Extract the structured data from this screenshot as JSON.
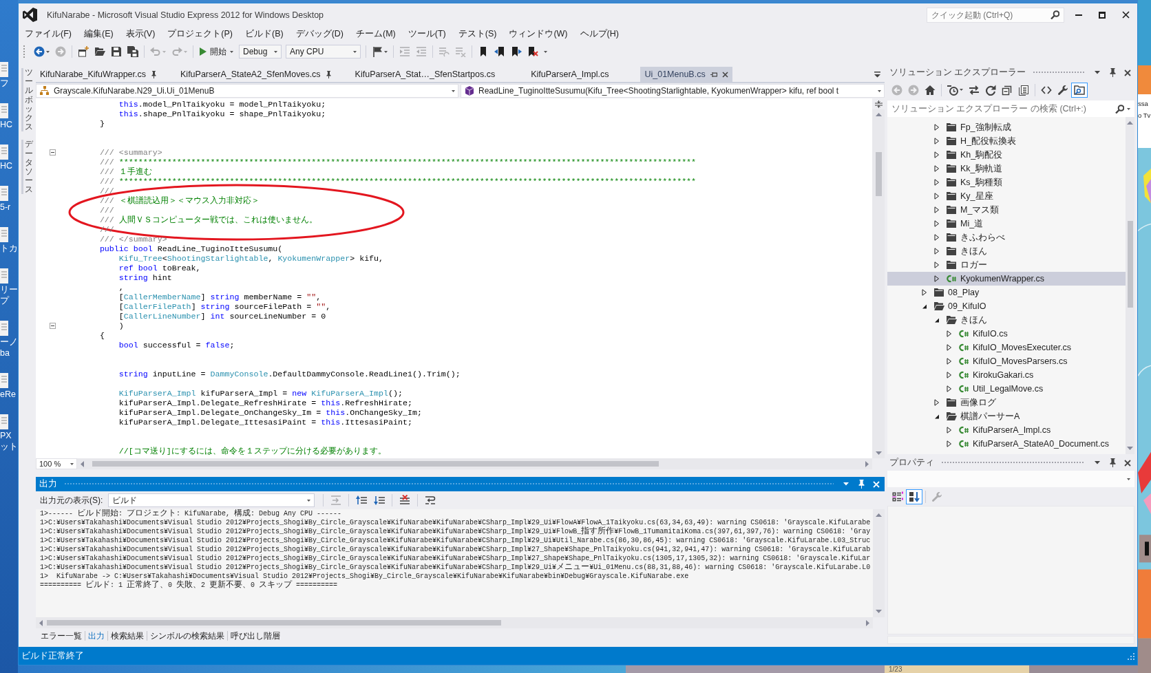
{
  "desktop": {
    "left_icons": [
      {
        "lines": [
          "フ"
        ]
      },
      {
        "lines": [
          "HC"
        ]
      },
      {
        "lines": [
          "HC"
        ]
      },
      {
        "lines": [
          "5-r"
        ]
      },
      {
        "lines": [
          "トカ"
        ]
      },
      {
        "lines": [
          "リー",
          "プ"
        ]
      },
      {
        "lines": [
          "ーノ",
          "ba"
        ]
      },
      {
        "lines": [
          "eRe"
        ]
      },
      {
        "lines": [
          "PX",
          "ット"
        ]
      }
    ],
    "right_texts": [
      "ssa",
      "o Tv"
    ],
    "taskbar_texts": [
      "1/23"
    ]
  },
  "title_bar": {
    "title": "KifuNarabe - Microsoft Visual Studio Express 2012 for Windows Desktop",
    "quick_launch": {
      "placeholder": "クイック起動 (Ctrl+Q)"
    }
  },
  "menu": [
    "ファイル(F)",
    "編集(E)",
    "表示(V)",
    "プロジェクト(P)",
    "ビルド(B)",
    "デバッグ(D)",
    "チーム(M)",
    "ツール(T)",
    "テスト(S)",
    "ウィンドウ(W)",
    "ヘルプ(H)"
  ],
  "toolbar": {
    "groups": [
      [
        {
          "kind": "nav_back",
          "disabled": false
        },
        {
          "kind": "nav_forward",
          "disabled": true
        }
      ],
      [
        {
          "kind": "new_project",
          "disabled": false
        },
        {
          "kind": "open_file",
          "disabled": false
        },
        {
          "kind": "save",
          "disabled": false
        },
        {
          "kind": "save_all",
          "disabled": false
        }
      ],
      [
        {
          "kind": "undo",
          "disabled": true
        },
        {
          "kind": "redo",
          "disabled": true
        }
      ],
      [
        {
          "kind": "start",
          "label": "開始",
          "disabled": false
        },
        {
          "kind": "combo",
          "value": "Debug",
          "disabled": false
        },
        {
          "kind": "combo",
          "value": "Any CPU",
          "disabled": false
        }
      ],
      [
        {
          "kind": "find",
          "disabled": false
        }
      ],
      [
        {
          "kind": "indent",
          "disabled": true
        },
        {
          "kind": "outdent",
          "disabled": true
        }
      ],
      [
        {
          "kind": "comment",
          "disabled": true
        },
        {
          "kind": "uncomment",
          "disabled": true
        }
      ],
      [
        {
          "kind": "bookmark",
          "disabled": false
        },
        {
          "kind": "bookmark_prev",
          "disabled": false
        },
        {
          "kind": "bookmark_next",
          "disabled": false
        },
        {
          "kind": "bookmark_clear",
          "disabled": false
        }
      ]
    ]
  },
  "tool_window_tabs": [
    "ツールボックス",
    "データソース"
  ],
  "editor": {
    "tabs": [
      {
        "label": "KifuNarabe_KifuWrapper.cs",
        "pinned": true,
        "selected": false
      },
      {
        "label": "KifuParserA_StateA2_SfenMoves.cs",
        "pinned": true,
        "selected": false
      },
      {
        "label": "KifuParserA_Stat…_SfenStartpos.cs",
        "pinned": false,
        "selected": false
      },
      {
        "label": "KifuParserA_Impl.cs",
        "pinned": false,
        "selected": false
      },
      {
        "label": "Ui_01MenuB.cs",
        "pinned": false,
        "selected": true
      }
    ],
    "type_dropdown": "Grayscale.KifuNarabe.N29_Ui.Ui_01MenuB",
    "member_dropdown": "ReadLine_TuginoItteSusumu(Kifu_Tree<ShootingStarlightable, KyokumenWrapper> kifu, ref bool t",
    "lines": [
      {
        "kind": "code",
        "fold": false,
        "circled": false,
        "segments": [
          {
            "kind": "keyword",
            "text": "            this"
          },
          {
            "kind": "plain",
            "text": ".model_PnlTaikyoku = model_PnlTaikyoku;"
          }
        ]
      },
      {
        "kind": "code",
        "fold": false,
        "circled": false,
        "segments": [
          {
            "kind": "keyword",
            "text": "            this"
          },
          {
            "kind": "plain",
            "text": ".shape_PnlTaikyoku = shape_PnlTaikyoku;"
          }
        ]
      },
      {
        "kind": "code",
        "fold": false,
        "circled": false,
        "segments": [
          {
            "kind": "plain",
            "text": "        }"
          }
        ]
      },
      {
        "kind": "blank",
        "fold": false,
        "circled": false
      },
      {
        "kind": "blank",
        "fold": false,
        "circled": false
      },
      {
        "kind": "code",
        "fold": true,
        "circled": false,
        "segments": [
          {
            "kind": "doc_marker",
            "text": "        /// <summary>"
          }
        ]
      },
      {
        "kind": "code",
        "fold": false,
        "circled": false,
        "segments": [
          {
            "kind": "doc_marker",
            "text": "        ///"
          },
          {
            "kind": "comment",
            "text": " ************************************************************************************************************************"
          }
        ]
      },
      {
        "kind": "code",
        "fold": false,
        "circled": false,
        "segments": [
          {
            "kind": "doc_marker",
            "text": "        ///"
          },
          {
            "kind": "comment",
            "text": " １手進む"
          }
        ]
      },
      {
        "kind": "code",
        "fold": false,
        "circled": false,
        "segments": [
          {
            "kind": "doc_marker",
            "text": "        ///"
          },
          {
            "kind": "comment",
            "text": " ************************************************************************************************************************"
          }
        ]
      },
      {
        "kind": "code",
        "fold": false,
        "circled": true,
        "segments": [
          {
            "kind": "doc_marker",
            "text": "        ///"
          }
        ]
      },
      {
        "kind": "code",
        "fold": false,
        "circled": true,
        "segments": [
          {
            "kind": "doc_marker",
            "text": "        ///"
          },
          {
            "kind": "comment",
            "text": " ＜棋譜読込用＞＜マウス入力非対応＞"
          }
        ]
      },
      {
        "kind": "code",
        "fold": false,
        "circled": true,
        "segments": [
          {
            "kind": "doc_marker",
            "text": "        ///"
          }
        ]
      },
      {
        "kind": "code",
        "fold": false,
        "circled": true,
        "segments": [
          {
            "kind": "doc_marker",
            "text": "        ///"
          },
          {
            "kind": "comment",
            "text": " 人間ＶＳコンピューター戦では、これは使いません。"
          }
        ]
      },
      {
        "kind": "code",
        "fold": false,
        "circled": true,
        "segments": [
          {
            "kind": "doc_marker",
            "text": "        ///"
          }
        ]
      },
      {
        "kind": "code",
        "fold": false,
        "circled": false,
        "segments": [
          {
            "kind": "doc_marker",
            "text": "        /// </summary>"
          }
        ]
      },
      {
        "kind": "code",
        "fold": false,
        "circled": false,
        "segments": [
          {
            "kind": "keyword",
            "text": "        public bool"
          },
          {
            "kind": "plain",
            "text": " ReadLine_TuginoItteSusumu("
          }
        ]
      },
      {
        "kind": "code",
        "fold": false,
        "circled": false,
        "segments": [
          {
            "kind": "type",
            "text": "            Kifu_Tree"
          },
          {
            "kind": "plain",
            "text": "<"
          },
          {
            "kind": "type",
            "text": "ShootingStarlightable"
          },
          {
            "kind": "plain",
            "text": ", "
          },
          {
            "kind": "type",
            "text": "KyokumenWrapper"
          },
          {
            "kind": "plain",
            "text": "> kifu,"
          }
        ]
      },
      {
        "kind": "code",
        "fold": false,
        "circled": false,
        "segments": [
          {
            "kind": "keyword",
            "text": "            ref bool"
          },
          {
            "kind": "plain",
            "text": " toBreak,"
          }
        ]
      },
      {
        "kind": "code",
        "fold": false,
        "circled": false,
        "segments": [
          {
            "kind": "keyword",
            "text": "            string"
          },
          {
            "kind": "plain",
            "text": " hint"
          }
        ]
      },
      {
        "kind": "code",
        "fold": false,
        "circled": false,
        "segments": [
          {
            "kind": "plain",
            "text": "            ,"
          }
        ]
      },
      {
        "kind": "code",
        "fold": false,
        "circled": false,
        "segments": [
          {
            "kind": "plain",
            "text": "            ["
          },
          {
            "kind": "type",
            "text": "CallerMemberName"
          },
          {
            "kind": "plain",
            "text": "] "
          },
          {
            "kind": "keyword",
            "text": "string"
          },
          {
            "kind": "plain",
            "text": " memberName = "
          },
          {
            "kind": "string",
            "text": "\"\""
          },
          {
            "kind": "plain",
            "text": ","
          }
        ]
      },
      {
        "kind": "code",
        "fold": false,
        "circled": false,
        "segments": [
          {
            "kind": "plain",
            "text": "            ["
          },
          {
            "kind": "type",
            "text": "CallerFilePath"
          },
          {
            "kind": "plain",
            "text": "] "
          },
          {
            "kind": "keyword",
            "text": "string"
          },
          {
            "kind": "plain",
            "text": " sourceFilePath = "
          },
          {
            "kind": "string",
            "text": "\"\""
          },
          {
            "kind": "plain",
            "text": ","
          }
        ]
      },
      {
        "kind": "code",
        "fold": false,
        "circled": false,
        "segments": [
          {
            "kind": "plain",
            "text": "            ["
          },
          {
            "kind": "type",
            "text": "CallerLineNumber"
          },
          {
            "kind": "plain",
            "text": "] "
          },
          {
            "kind": "keyword",
            "text": "int"
          },
          {
            "kind": "plain",
            "text": " sourceLineNumber = 0"
          }
        ]
      },
      {
        "kind": "code",
        "fold": true,
        "circled": false,
        "segments": [
          {
            "kind": "plain",
            "text": "            )"
          }
        ]
      },
      {
        "kind": "code",
        "fold": false,
        "circled": false,
        "segments": [
          {
            "kind": "plain",
            "text": "        {"
          }
        ]
      },
      {
        "kind": "code",
        "fold": false,
        "circled": false,
        "segments": [
          {
            "kind": "keyword",
            "text": "            bool"
          },
          {
            "kind": "plain",
            "text": " successful = "
          },
          {
            "kind": "keyword",
            "text": "false"
          },
          {
            "kind": "plain",
            "text": ";"
          }
        ]
      },
      {
        "kind": "blank",
        "fold": false,
        "circled": false
      },
      {
        "kind": "blank",
        "fold": false,
        "circled": false
      },
      {
        "kind": "code",
        "fold": false,
        "circled": false,
        "segments": [
          {
            "kind": "keyword",
            "text": "            string"
          },
          {
            "kind": "plain",
            "text": " inputLine = "
          },
          {
            "kind": "type",
            "text": "DammyConsole"
          },
          {
            "kind": "plain",
            "text": ".DefaultDammyConsole.ReadLine1().Trim();"
          }
        ]
      },
      {
        "kind": "blank",
        "fold": false,
        "circled": false
      },
      {
        "kind": "code",
        "fold": false,
        "circled": false,
        "segments": [
          {
            "kind": "type",
            "text": "            KifuParserA_Impl"
          },
          {
            "kind": "plain",
            "text": " kifuParserA_Impl = "
          },
          {
            "kind": "keyword",
            "text": "new"
          },
          {
            "kind": "type",
            "text": " KifuParserA_Impl"
          },
          {
            "kind": "plain",
            "text": "();"
          }
        ]
      },
      {
        "kind": "code",
        "fold": false,
        "circled": false,
        "segments": [
          {
            "kind": "plain",
            "text": "            kifuParserA_Impl.Delegate_RefreshHirate = "
          },
          {
            "kind": "keyword",
            "text": "this"
          },
          {
            "kind": "plain",
            "text": ".RefreshHirate;"
          }
        ]
      },
      {
        "kind": "code",
        "fold": false,
        "circled": false,
        "segments": [
          {
            "kind": "plain",
            "text": "            kifuParserA_Impl.Delegate_OnChangeSky_Im = "
          },
          {
            "kind": "keyword",
            "text": "this"
          },
          {
            "kind": "plain",
            "text": ".OnChangeSky_Im;"
          }
        ]
      },
      {
        "kind": "code",
        "fold": false,
        "circled": false,
        "segments": [
          {
            "kind": "plain",
            "text": "            kifuParserA_Impl.Delegate_IttesasiPaint = "
          },
          {
            "kind": "keyword",
            "text": "this"
          },
          {
            "kind": "plain",
            "text": ".IttesasiPaint;"
          }
        ]
      },
      {
        "kind": "blank",
        "fold": false,
        "circled": false
      },
      {
        "kind": "blank",
        "fold": false,
        "circled": false
      },
      {
        "kind": "code",
        "fold": false,
        "circled": false,
        "segments": [
          {
            "kind": "comment",
            "text": "            //[コマ送り]にするには、命令を１ステップに分ける必要があります。"
          }
        ]
      }
    ],
    "zoom": "100 %"
  },
  "solution_explorer": {
    "title": "ソリューション エクスプローラー",
    "active": false,
    "toolbar": [
      [
        {
          "kind": "se_back",
          "disabled": true,
          "on": false
        },
        {
          "kind": "se_forward",
          "disabled": true,
          "on": false
        },
        {
          "kind": "home",
          "disabled": false,
          "on": false
        }
      ],
      [
        {
          "kind": "history",
          "disabled": false,
          "on": false
        },
        {
          "kind": "sync",
          "disabled": false,
          "on": false
        },
        {
          "kind": "refresh",
          "disabled": false,
          "on": false
        },
        {
          "kind": "collapse_all",
          "disabled": false,
          "on": false
        },
        {
          "kind": "properties",
          "disabled": false,
          "on": false
        }
      ],
      [
        {
          "kind": "view_code",
          "disabled": false,
          "on": false
        },
        {
          "kind": "wrench",
          "disabled": false,
          "on": false
        },
        {
          "kind": "preview",
          "disabled": false,
          "on": true
        }
      ]
    ],
    "search": {
      "placeholder": "ソリューション エクスプローラー の検索 (Ctrl+:)"
    },
    "tree": {
      "continued_items": [
        {
          "label": "Fp_強制転成",
          "kind": "folder",
          "expanded": false,
          "selected": false
        },
        {
          "label": "H_配役転換表",
          "kind": "folder",
          "expanded": false,
          "selected": false
        },
        {
          "label": "Kh_駒配役",
          "kind": "folder",
          "expanded": false,
          "selected": false
        },
        {
          "label": "Kk_駒軌道",
          "kind": "folder",
          "expanded": false,
          "selected": false
        },
        {
          "label": "Ks_駒種類",
          "kind": "folder",
          "expanded": false,
          "selected": false
        },
        {
          "label": "Ky_星座",
          "kind": "folder",
          "expanded": false,
          "selected": false
        },
        {
          "label": "M_マス類",
          "kind": "folder",
          "expanded": false,
          "selected": false
        },
        {
          "label": "Mi_道",
          "kind": "folder",
          "expanded": false,
          "selected": false
        },
        {
          "label": "きふわらべ",
          "kind": "folder",
          "expanded": false,
          "selected": false
        },
        {
          "label": "きほん",
          "kind": "folder",
          "expanded": false,
          "selected": false
        },
        {
          "label": "ロガー",
          "kind": "folder",
          "expanded": false,
          "selected": false
        },
        {
          "label": "KyokumenWrapper.cs",
          "kind": "csharp_file",
          "expanded": false,
          "selected": true
        }
      ],
      "items": [
        {
          "label": "08_Play",
          "kind": "folder",
          "expanded": false,
          "selected": false
        },
        {
          "label": "09_KifuIO",
          "kind": "folder",
          "expanded": true,
          "selected": false,
          "children": [
            {
              "label": "きほん",
              "kind": "folder",
              "expanded": true,
              "selected": false,
              "children": [
                {
                  "label": "KifuIO.cs",
                  "kind": "csharp_file",
                  "expanded": false,
                  "selected": false
                },
                {
                  "label": "KifuIO_MovesExecuter.cs",
                  "kind": "csharp_file",
                  "expanded": false,
                  "selected": false
                },
                {
                  "label": "KifuIO_MovesParsers.cs",
                  "kind": "csharp_file",
                  "expanded": false,
                  "selected": false
                },
                {
                  "label": "KirokuGakari.cs",
                  "kind": "csharp_file",
                  "expanded": false,
                  "selected": false
                },
                {
                  "label": "Util_LegalMove.cs",
                  "kind": "csharp_file",
                  "expanded": false,
                  "selected": false
                }
              ]
            },
            {
              "label": "画像ログ",
              "kind": "folder",
              "expanded": false,
              "selected": false
            },
            {
              "label": "棋譜パーサーA",
              "kind": "folder",
              "expanded": true,
              "selected": false,
              "children": [
                {
                  "label": "KifuParserA_Impl.cs",
                  "kind": "csharp_file",
                  "expanded": false,
                  "selected": false
                },
                {
                  "label": "KifuParserA_StateA0_Document.cs",
                  "kind": "csharp_file",
                  "expanded": false,
                  "selected": false
                }
              ]
            }
          ]
        }
      ]
    }
  },
  "properties": {
    "title": "プロパティ",
    "active": false,
    "toolbar": [
      [
        {
          "kind": "categorized",
          "disabled": false,
          "on": false
        },
        {
          "kind": "alphabetical",
          "disabled": false,
          "on": true
        }
      ],
      [
        {
          "kind": "prop_pages",
          "disabled": true,
          "on": false
        }
      ]
    ]
  },
  "output": {
    "title": "出力",
    "active": true,
    "source_label": "出力元の表示(S):",
    "source": "ビルド",
    "toolbar": [
      [
        {
          "kind": "goto_line",
          "disabled": true,
          "on": false
        }
      ],
      [
        {
          "kind": "prev_message",
          "disabled": false,
          "on": false
        },
        {
          "kind": "next_message",
          "disabled": false,
          "on": false
        }
      ],
      [
        {
          "kind": "clear_all",
          "disabled": false,
          "on": false
        }
      ],
      [
        {
          "kind": "word_wrap",
          "disabled": false,
          "on": false
        }
      ]
    ],
    "lines": [
      "1>------ ビルド開始: プロジェクト: KifuNarabe, 構成: Debug Any CPU ------",
      "1>C:¥Users¥Takahashi¥Documents¥Visual Studio 2012¥Projects_Shogi¥By_Circle_Grayscale¥KifuNarabe¥KifuNarabe¥CSharp_Impl¥29_Ui¥FlowA¥FlowA_1Taikyoku.cs(63,34,63,49): warning CS0618: 'Grayscale.KifuLarabe",
      "1>C:¥Users¥Takahashi¥Documents¥Visual Studio 2012¥Projects_Shogi¥By_Circle_Grayscale¥KifuNarabe¥KifuNarabe¥CSharp_Impl¥29_Ui¥FlowB_指す所作¥FlowB_1TumamitaiKoma.cs(397,61,397,76): warning CS0618: 'Gray",
      "1>C:¥Users¥Takahashi¥Documents¥Visual Studio 2012¥Projects_Shogi¥By_Circle_Grayscale¥KifuNarabe¥KifuNarabe¥CSharp_Impl¥29_Ui¥Util_Narabe.cs(86,30,86,45): warning CS0618: 'Grayscale.KifuLarabe.L03_Struc",
      "1>C:¥Users¥Takahashi¥Documents¥Visual Studio 2012¥Projects_Shogi¥By_Circle_Grayscale¥KifuNarabe¥KifuNarabe¥CSharp_Impl¥27_Shape¥Shape_PnlTaikyoku.cs(941,32,941,47): warning CS0618: 'Grayscale.KifuLarab",
      "1>C:¥Users¥Takahashi¥Documents¥Visual Studio 2012¥Projects_Shogi¥By_Circle_Grayscale¥KifuNarabe¥KifuNarabe¥CSharp_Impl¥27_Shape¥Shape_PnlTaikyoku.cs(1305,17,1305,32): warning CS0618: 'Grayscale.KifuLar",
      "1>C:¥Users¥Takahashi¥Documents¥Visual Studio 2012¥Projects_Shogi¥By_Circle_Grayscale¥KifuNarabe¥KifuNarabe¥CSharp_Impl¥29_Ui¥メニュー¥Ui_01Menu.cs(88,31,88,46): warning CS0618: 'Grayscale.KifuLarabe.L0",
      "1>  KifuNarabe -> C:¥Users¥Takahashi¥Documents¥Visual Studio 2012¥Projects_Shogi¥By_Circle_Grayscale¥KifuNarabe¥KifuNarabe¥bin¥Debug¥Grayscale.KifuNarabe.exe",
      "========== ビルド: 1 正常終了、0 失敗、2 更新不要、0 スキップ =========="
    ],
    "tabs": [
      {
        "label": "エラー一覧",
        "selected": false
      },
      {
        "label": "出力",
        "selected": true
      },
      {
        "label": "検索結果",
        "selected": false
      },
      {
        "label": "シンボルの検索結果",
        "selected": false
      },
      {
        "label": "呼び出し階層",
        "selected": false
      }
    ]
  },
  "status_bar": {
    "text": "ビルド正常終了"
  }
}
